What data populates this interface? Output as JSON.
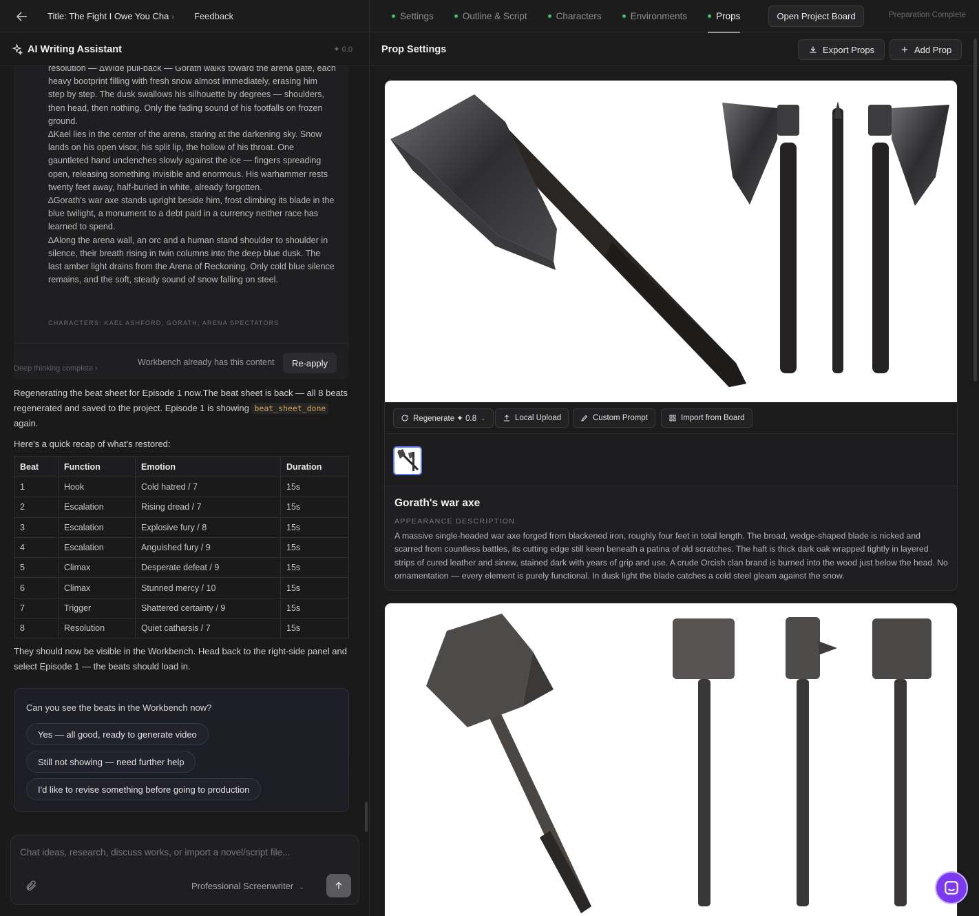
{
  "topbar": {
    "title": "Title: The Fight I Owe You Cha",
    "feedback": "Feedback",
    "nav": [
      {
        "label": "Settings",
        "active": false
      },
      {
        "label": "Outline & Script",
        "active": false
      },
      {
        "label": "Characters",
        "active": false
      },
      {
        "label": "Environments",
        "active": false
      },
      {
        "label": "Props",
        "active": true
      }
    ],
    "open_board": "Open Project Board",
    "status": "Preparation Complete"
  },
  "assistant": {
    "title": "AI Writing Assistant",
    "credits": "✦ 0.0",
    "scene_paragraphs": [
      "resolution — ∆Wide pull-back — Gorath walks toward the arena gate, each heavy bootprint filling with fresh snow almost immediately, erasing him step by step. The dusk swallows his silhouette by degrees — shoulders, then head, then nothing. Only the fading sound of his footfalls on frozen ground.",
      "∆Kael lies in the center of the arena, staring at the darkening sky. Snow lands on his open visor, his split lip, the hollow of his throat. One gauntleted hand unclenches slowly against the ice — fingers spreading open, releasing something invisible and enormous. His warhammer rests twenty feet away, half-buried in white, already forgotten.",
      "∆Gorath's war axe stands upright beside him, frost climbing its blade in the blue twilight, a monument to a debt paid in a currency neither race has learned to spend.",
      "∆Along the arena wall, an orc and a human stand shoulder to shoulder in silence, their breath rising in twin columns into the deep blue dusk. The last amber light drains from the Arena of Reckoning. Only cold blue silence remains, and the soft, steady sound of snow falling on steel."
    ],
    "characters_line": "CHARACTERS: KAEL ASHFORD, GORATH, ARENA SPECTATORS",
    "workbench_note": "Workbench already has this content",
    "reapply": "Re-apply",
    "deep_thinking": "Deep thinking complete",
    "msg1_a": "Regenerating the beat sheet for Episode 1 now.The beat sheet is back — all 8 beats regenerated and saved to the project. Episode 1 is showing",
    "msg1_code": "beat_sheet_done",
    "msg1_b": "again.",
    "recap": "Here's a quick recap of what's restored:",
    "table": {
      "headers": [
        "Beat",
        "Function",
        "Emotion",
        "Duration"
      ],
      "rows": [
        [
          "1",
          "Hook",
          "Cold hatred / 7",
          "15s"
        ],
        [
          "2",
          "Escalation",
          "Rising dread / 7",
          "15s"
        ],
        [
          "3",
          "Escalation",
          "Explosive fury / 8",
          "15s"
        ],
        [
          "4",
          "Escalation",
          "Anguished fury / 9",
          "15s"
        ],
        [
          "5",
          "Climax",
          "Desperate defeat / 9",
          "15s"
        ],
        [
          "6",
          "Climax",
          "Stunned mercy / 10",
          "15s"
        ],
        [
          "7",
          "Trigger",
          "Shattered certainty / 9",
          "15s"
        ],
        [
          "8",
          "Resolution",
          "Quiet catharsis / 7",
          "15s"
        ]
      ]
    },
    "after_table": "They should now be visible in the Workbench. Head back to the right-side panel and select Episode 1 — the beats should load in.",
    "question": "Can you see the beats in the Workbench now?",
    "options": [
      "Yes — all good, ready to generate video",
      "Still not showing — need further help",
      "I'd like to revise something before going to production"
    ],
    "input_placeholder": "Chat ideas, research, discuss works, or import a novel/script file...",
    "mode": "Professional Screenwriter"
  },
  "props_panel": {
    "title": "Prop Settings",
    "export": "Export Props",
    "add": "Add Prop",
    "toolbar": {
      "regenerate": "Regenerate ✦ 0.8",
      "local_upload": "Local Upload",
      "custom_prompt": "Custom Prompt",
      "import_board": "Import from Board"
    },
    "props": [
      {
        "name": "Gorath's war axe",
        "appearance_label": "APPEARANCE DESCRIPTION",
        "appearance": "A massive single-headed war axe forged from blackened iron, roughly four feet in total length. The broad, wedge-shaped blade is nicked and scarred from countless battles, its cutting edge still keen beneath a patina of old scratches. The haft is thick dark oak wrapped tightly in layered strips of cured leather and sinew, stained dark with years of grip and use. A crude Orcish clan brand is burned into the wood just below the head. No ornamentation — every element is purely functional. In dusk light the blade catches a cold steel gleam against the snow."
      }
    ]
  },
  "colors": {
    "nav_dot": "#38c172",
    "thumb_border": "#5b7cf5",
    "fab": "#7b3af0"
  }
}
